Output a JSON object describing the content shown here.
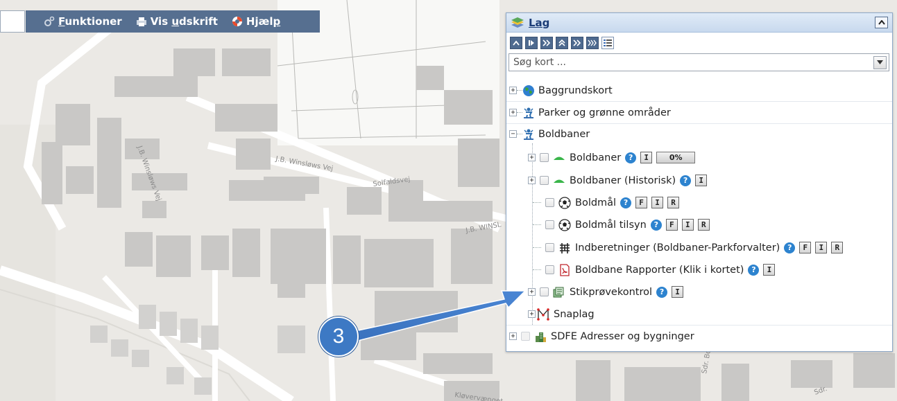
{
  "toolbar": {
    "items": [
      {
        "label_pre": "",
        "label_u": "F",
        "label_post": "unktioner",
        "icon": "gears-icon"
      },
      {
        "label_pre": "Vis ",
        "label_u": "u",
        "label_post": "dskrift",
        "icon": "printer-icon"
      },
      {
        "label_pre": "Hjæl",
        "label_u": "p",
        "label_post": "",
        "icon": "lifebuoy-icon"
      }
    ]
  },
  "map": {
    "street_labels": [
      "J.B. Winsløws Vej",
      "Solfaldsvej",
      "J.B. WINSL",
      "Kløvervænget",
      "J.B. Winsløws Vej",
      "Sdr. Boulevard",
      "Sdr."
    ]
  },
  "panel": {
    "title": "Lag",
    "search_placeholder": "Søg kort ...",
    "tree": [
      {
        "label": "Baggrundskort",
        "icon": "globe-icon",
        "level": 0
      },
      {
        "label": "Parker og grønne områder",
        "icon": "park-person-icon",
        "level": 0
      },
      {
        "label": "Boldbaner",
        "icon": "park-person-icon",
        "level": 0,
        "expanded": true
      },
      {
        "label": "Boldbaner",
        "icon": "green-area-icon",
        "level": 1,
        "tags": [
          "I"
        ],
        "progress": "0%"
      },
      {
        "label": "Boldbaner (Historisk)",
        "icon": "green-area-icon",
        "level": 1,
        "tags": [
          "I"
        ]
      },
      {
        "label": "Boldmål",
        "icon": "football-icon",
        "level": 1,
        "tags": [
          "F",
          "I",
          "R"
        ]
      },
      {
        "label": "Boldmål tilsyn",
        "icon": "football-icon",
        "level": 1,
        "tags": [
          "F",
          "I",
          "R"
        ]
      },
      {
        "label": "Indberetninger (Boldbaner-Parkforvalter)",
        "icon": "bench-icon",
        "level": 1,
        "tags": [
          "F",
          "I",
          "R"
        ]
      },
      {
        "label": "Boldbane Rapporter (Klik i kortet)",
        "icon": "pdf-icon",
        "level": 1,
        "tags": [
          "I"
        ]
      },
      {
        "label": "Stikprøvekontrol",
        "icon": "stack-icon",
        "level": 1,
        "tags": [
          "I"
        ]
      },
      {
        "label": "Snaplag",
        "icon": "snap-icon",
        "level": 1
      },
      {
        "label": "SDFE Adresser og bygninger",
        "icon": "buildings-icon",
        "level": 0
      }
    ]
  },
  "callout": {
    "number": "3"
  },
  "colors": {
    "toolbar_bg": "#566f90",
    "panel_title": "#1b3c77",
    "help_blue": "#2d83cf",
    "callout_blue": "#3d79c4"
  }
}
